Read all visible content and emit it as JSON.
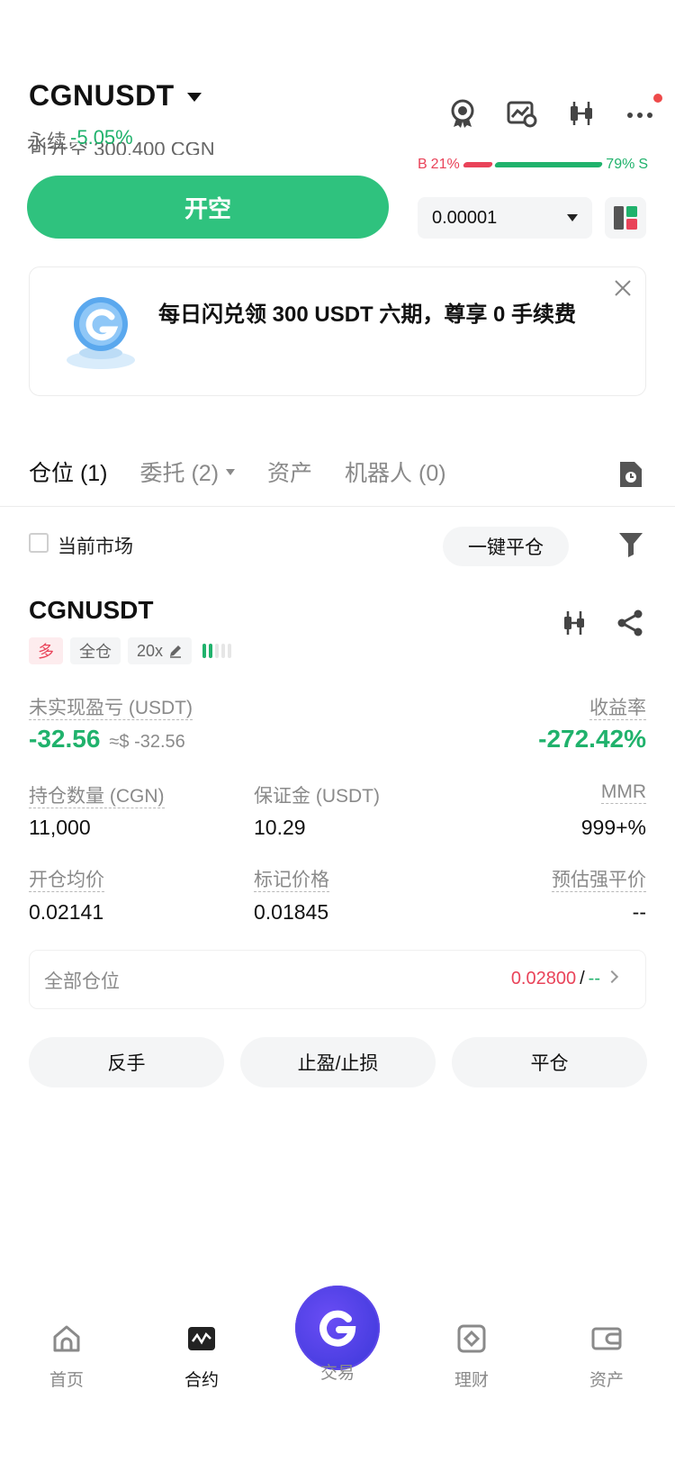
{
  "header": {
    "symbol": "CGNUSDT",
    "market_type": "永续",
    "change": "-5.05%",
    "ghost_text": "可开空 300,400 CGN"
  },
  "order_panel": {
    "buy_label": "B",
    "buy_pct": "21%",
    "sell_pct": "79%",
    "sell_label": "S",
    "buy_ratio": 0.21,
    "short_button": "开空",
    "price_precision": "0.00001"
  },
  "banner": {
    "text": "每日闪兑领 300 USDT 六期，尊享 0 手续费"
  },
  "tabs": [
    {
      "label": "仓位 (1)"
    },
    {
      "label": "委托 (2)"
    },
    {
      "label": "资产"
    },
    {
      "label": "机器人 (0)"
    }
  ],
  "filter": {
    "current_market_label": "当前市场",
    "close_all_label": "一键平仓"
  },
  "position": {
    "symbol": "CGNUSDT",
    "side_tag": "多",
    "margin_mode_tag": "全仓",
    "leverage_tag": "20x",
    "unrealized_pnl_label": "未实现盈亏 (USDT)",
    "unrealized_pnl": "-32.56",
    "unrealized_pnl_usd": "≈$ -32.56",
    "roe_label": "收益率",
    "roe": "-272.42%",
    "size_label": "持仓数量 (CGN)",
    "size": "11,000",
    "margin_label": "保证金 (USDT)",
    "margin": "10.29",
    "mmr_label": "MMR",
    "mmr": "999+%",
    "entry_price_label": "开仓均价",
    "entry_price": "0.02141",
    "mark_price_label": "标记价格",
    "mark_price": "0.01845",
    "liq_price_label": "预估强平价",
    "liq_price": "--",
    "all_positions_label": "全部仓位",
    "all_positions_tp": "0.02800",
    "all_positions_sep": "/",
    "all_positions_sl": "--",
    "actions": {
      "reverse": "反手",
      "tp_sl": "止盈/止损",
      "close": "平仓"
    }
  },
  "nav": [
    {
      "label": "首页",
      "icon": "home-icon"
    },
    {
      "label": "合约",
      "icon": "futures-icon"
    },
    {
      "label": "交易",
      "icon": "trade-logo-icon"
    },
    {
      "label": "理财",
      "icon": "earn-icon"
    },
    {
      "label": "资产",
      "icon": "wallet-icon"
    }
  ],
  "colors": {
    "green": "#20b26c",
    "red": "#e94359",
    "short_button": "#2fc27e",
    "trade_button": "#3a37d8"
  }
}
